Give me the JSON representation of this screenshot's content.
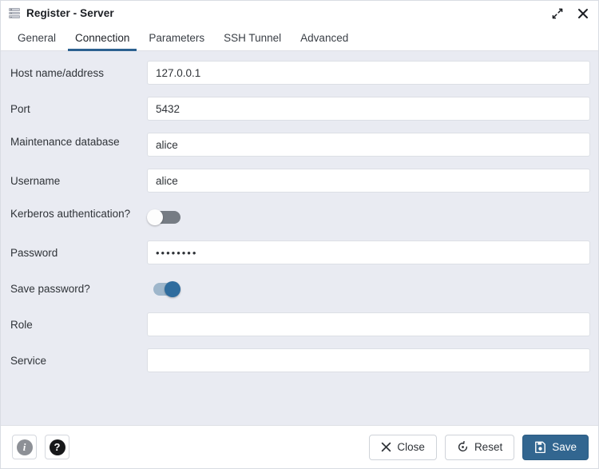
{
  "window": {
    "title": "Register - Server",
    "icon": "server-stack-icon",
    "controls": [
      {
        "name": "maximize-button",
        "icon": "expand-arrows-icon"
      },
      {
        "name": "close-button",
        "icon": "close-icon"
      }
    ]
  },
  "tabs": [
    {
      "label": "General",
      "active": false
    },
    {
      "label": "Connection",
      "active": true
    },
    {
      "label": "Parameters",
      "active": false
    },
    {
      "label": "SSH Tunnel",
      "active": false
    },
    {
      "label": "Advanced",
      "active": false
    }
  ],
  "form": {
    "host": {
      "label": "Host name/address",
      "value": "127.0.0.1",
      "placeholder": ""
    },
    "port": {
      "label": "Port",
      "value": "5432",
      "placeholder": ""
    },
    "maintenance_db": {
      "label": "Maintenance database",
      "value": "alice",
      "placeholder": ""
    },
    "username": {
      "label": "Username",
      "value": "alice",
      "placeholder": ""
    },
    "kerberos": {
      "label": "Kerberos authentication?",
      "state": "off"
    },
    "password": {
      "label": "Password",
      "value": "••••••••",
      "placeholder": ""
    },
    "save_password": {
      "label": "Save password?",
      "state": "on"
    },
    "role": {
      "label": "Role",
      "value": "",
      "placeholder": ""
    },
    "service": {
      "label": "Service",
      "value": "",
      "placeholder": ""
    }
  },
  "footer": {
    "info_label": "i",
    "help_label": "?",
    "close_label": "Close",
    "reset_label": "Reset",
    "save_label": "Save"
  },
  "colors": {
    "accent": "#326690",
    "tab_underline": "#2c6190",
    "body_background": "#e9ebf2",
    "toggle_on_knob": "#2f6c9e",
    "toggle_off_track": "#767c84"
  }
}
